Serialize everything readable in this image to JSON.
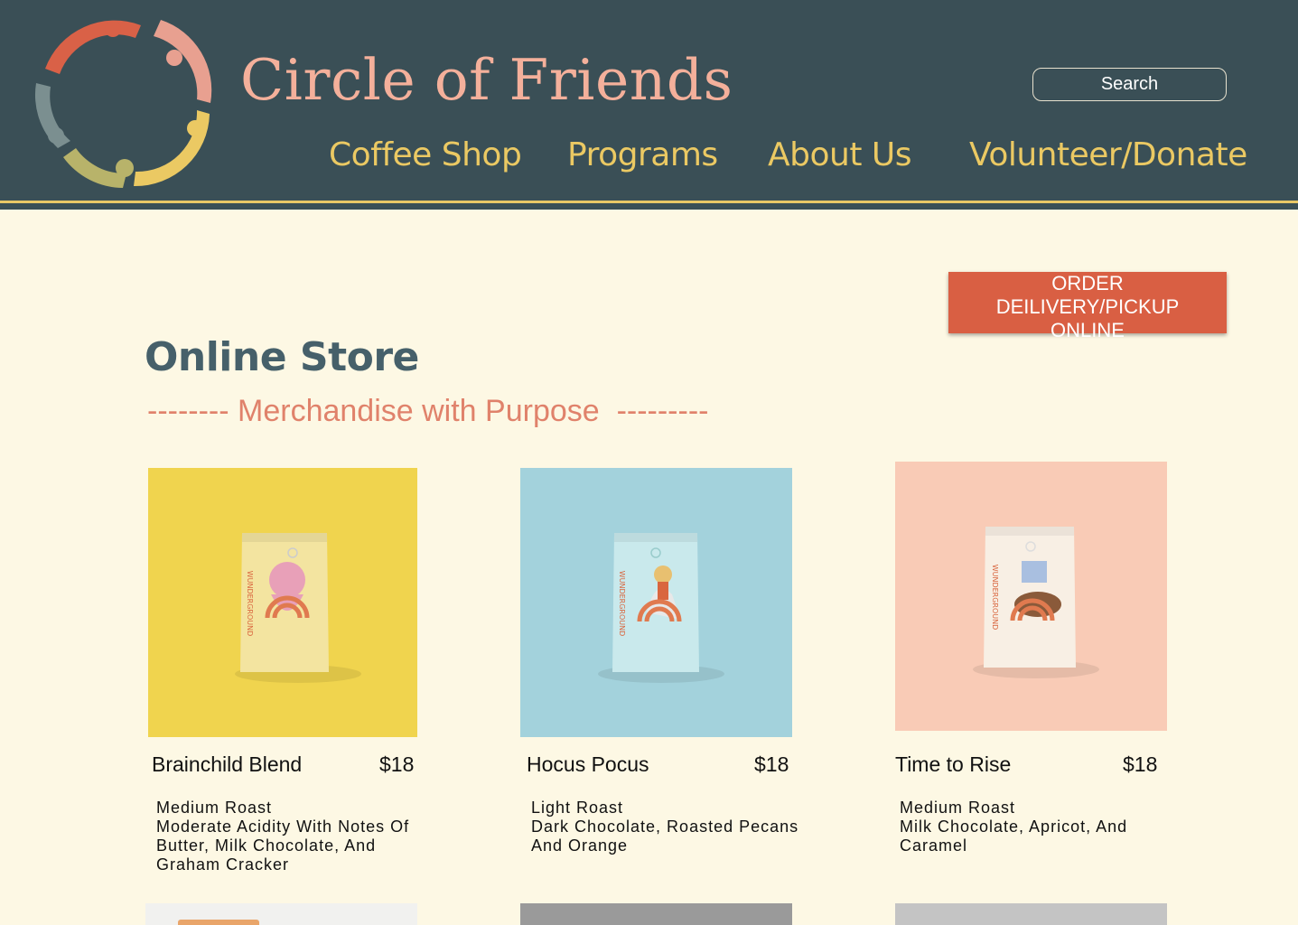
{
  "site": {
    "title": "Circle of Friends",
    "search_placeholder": "Search"
  },
  "nav": [
    {
      "label": "Coffee Shop"
    },
    {
      "label": "Programs"
    },
    {
      "label": "About Us"
    },
    {
      "label": "Volunteer/Donate"
    }
  ],
  "order_button": {
    "line1": "ORDER DEILIVERY/PICKUP",
    "line2": "ONLINE"
  },
  "page": {
    "title": "Online Store",
    "subtitle": "-------- Merchandise with Purpose  ---------"
  },
  "products": [
    {
      "name": "Brainchild Blend",
      "price": "$18",
      "roast": "Medium Roast",
      "notes": [
        "Moderate Acidity With Notes Of",
        "Butter, Milk Chocolate, And",
        "Graham Cracker"
      ],
      "bag_label": "WUNDERGROUND",
      "bg_color": "#f0d44e",
      "bag_color": "#f3e4a0"
    },
    {
      "name": "Hocus Pocus",
      "price": "$18",
      "roast": "Light Roast",
      "notes": [
        "Dark Chocolate, Roasted Pecans",
        "And Orange"
      ],
      "bag_label": "WUNDERGROUND",
      "bg_color": "#a3d2dc",
      "bag_color": "#c9e9ec"
    },
    {
      "name": "Time to Rise",
      "price": "$18",
      "roast": "Medium Roast",
      "notes": [
        "Milk Chocolate, Apricot, And",
        "Caramel"
      ],
      "bag_label": "WUNDERGROUND",
      "bg_color": "#f9cbb6",
      "bag_color": "#f8efe4"
    }
  ],
  "colors": {
    "header_bg": "#3a4f56",
    "accent_yellow": "#ebc963",
    "title_pink": "#f4b09b",
    "button_red": "#d95f43",
    "page_bg": "#fdf8e4"
  }
}
